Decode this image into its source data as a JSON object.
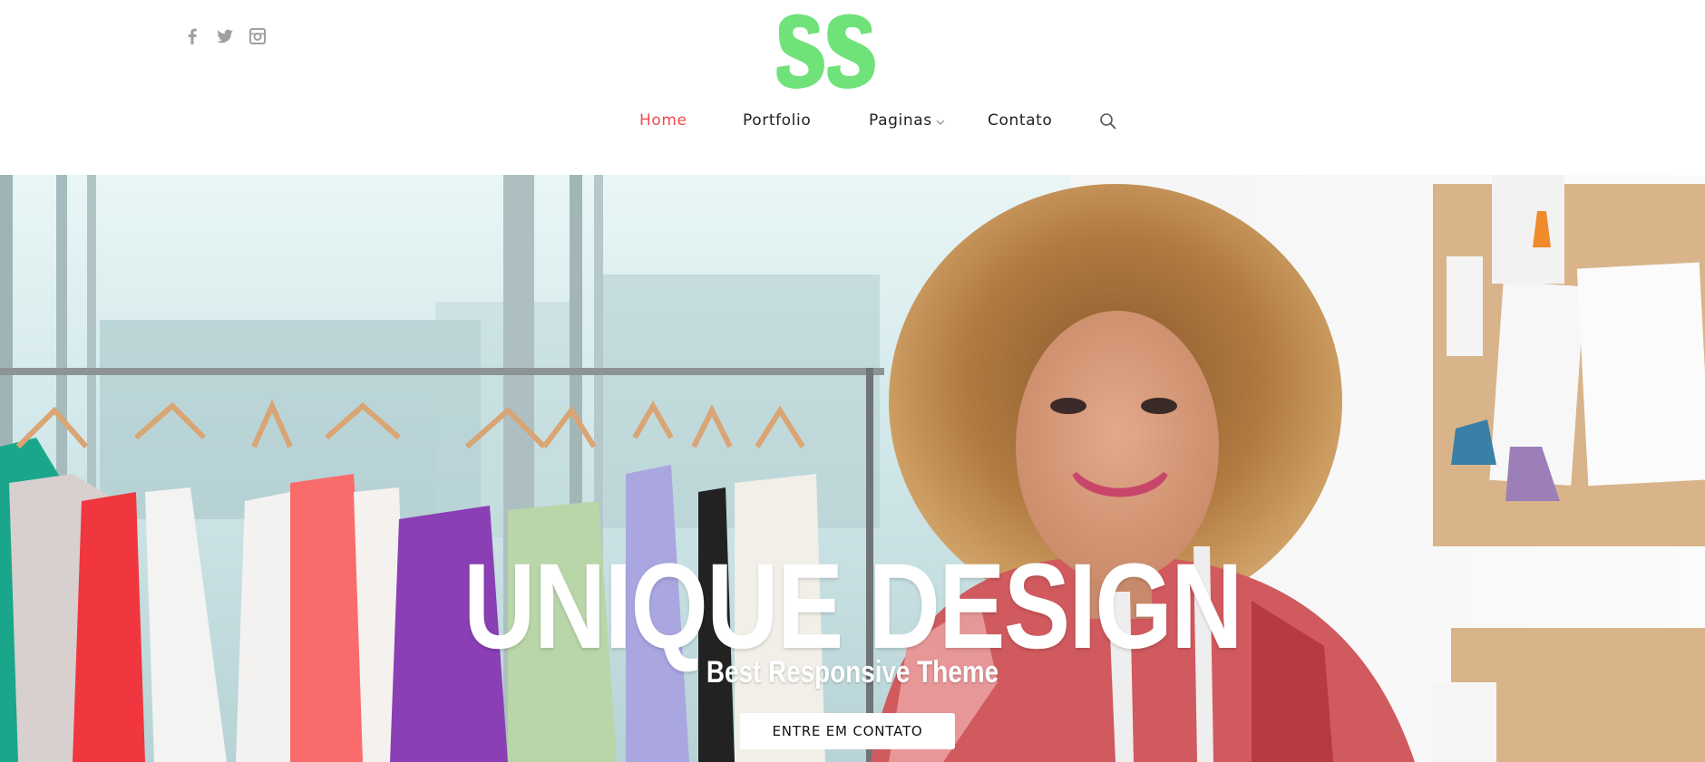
{
  "header": {
    "social": [
      {
        "name": "facebook-icon"
      },
      {
        "name": "twitter-icon"
      },
      {
        "name": "instagram-icon"
      }
    ],
    "logo_text": "SS",
    "logo_color": "#6fe27a",
    "nav": {
      "home": "Home",
      "portfolio": "Portfolio",
      "paginas": "Paginas",
      "contato": "Contato",
      "active_color": "#ef4b4b"
    }
  },
  "hero": {
    "title": "UNIQUE DESIGN",
    "subtitle": "Best Responsive Theme",
    "cta": "ENTRE EM CONTATO"
  }
}
